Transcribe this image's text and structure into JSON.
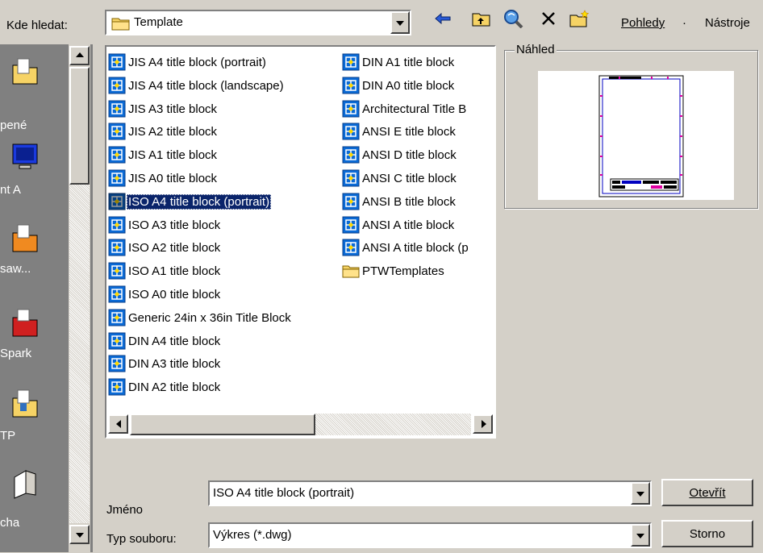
{
  "toolbar": {
    "lookin_label": "Kde hledat:",
    "lookin_value": "Template",
    "menu_views": "Pohledy",
    "menu_separator": "·",
    "menu_tools": "Nástroje",
    "icons": [
      "back-arrow-icon",
      "up-folder-icon",
      "search-web-icon",
      "delete-icon",
      "new-folder-icon"
    ]
  },
  "places": [
    {
      "label": ""
    },
    {
      "label": "pené"
    },
    {
      "label": "nt A"
    },
    {
      "label": "saw..."
    },
    {
      "label": "Spark"
    },
    {
      "label": "TP"
    },
    {
      "label": "cha"
    }
  ],
  "files": {
    "column1": [
      "JIS A4 title block (portrait)",
      "JIS A4 title block (landscape)",
      "JIS A3 title block",
      "JIS A2 title block",
      "JIS A1 title block",
      "JIS A0 title block",
      "ISO A4 title block (portrait)",
      "ISO A3 title block",
      "ISO A2 title block",
      "ISO A1 title block",
      "ISO A0 title block",
      "Generic 24in x 36in Title Block",
      "DIN A4 title block",
      "DIN A3 title block",
      "DIN A2 title block"
    ],
    "column2": [
      "DIN A1 title block",
      "DIN A0 title block",
      "Architectural Title B",
      "ANSI E title block",
      "ANSI D title block",
      "ANSI C title block",
      "ANSI B title block",
      "ANSI A title block",
      "ANSI A title block (p",
      "PTWTemplates"
    ],
    "selected": "ISO A4 title block (portrait)"
  },
  "preview": {
    "label": "Náhled"
  },
  "filename": {
    "label": "Jméno",
    "value": "ISO A4 title block (portrait)"
  },
  "filetype": {
    "label": "Typ souboru:",
    "value": "Výkres (*.dwg)"
  },
  "buttons": {
    "open": "Otevřít",
    "cancel": "Storno"
  },
  "colors": {
    "dialog_bg": "#d4d0c8",
    "places_bg": "#808080",
    "selection": "#0a246a",
    "template_icon": "#0a6ad6"
  }
}
